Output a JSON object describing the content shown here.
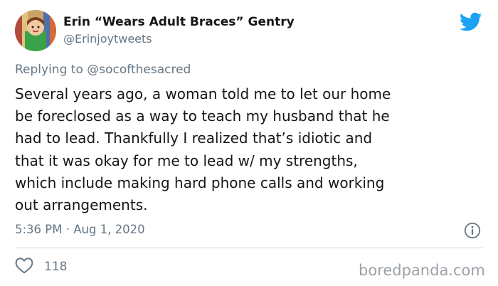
{
  "tweet": {
    "display_name": "Erin “Wears Adult Braces” Gentry",
    "handle": "@Erinjoytweets",
    "replying_to_prefix": "Replying to ",
    "replying_to_handle": "@socofthesacred",
    "text": "Several years ago, a woman told me to let our home\nbe foreclosed as a way to teach my husband that he\nhad to lead. Thankfully I realized that’s idiotic and\nthat it was okay for me to lead w/ my strengths,\nwhich include making hard phone calls and working\nout arrangements.",
    "timestamp": "5:36 PM · Aug 1, 2020",
    "like_count": "118"
  },
  "icons": {
    "brand": "twitter-bird-icon",
    "info": "info-icon",
    "like": "heart-icon"
  },
  "watermark": "boredpanda.com",
  "colors": {
    "twitter_blue": "#1da1f2",
    "text": "#14171a",
    "secondary_text": "#657786",
    "divider": "#ccd6dd",
    "avatar_green": "#3aa34a"
  }
}
